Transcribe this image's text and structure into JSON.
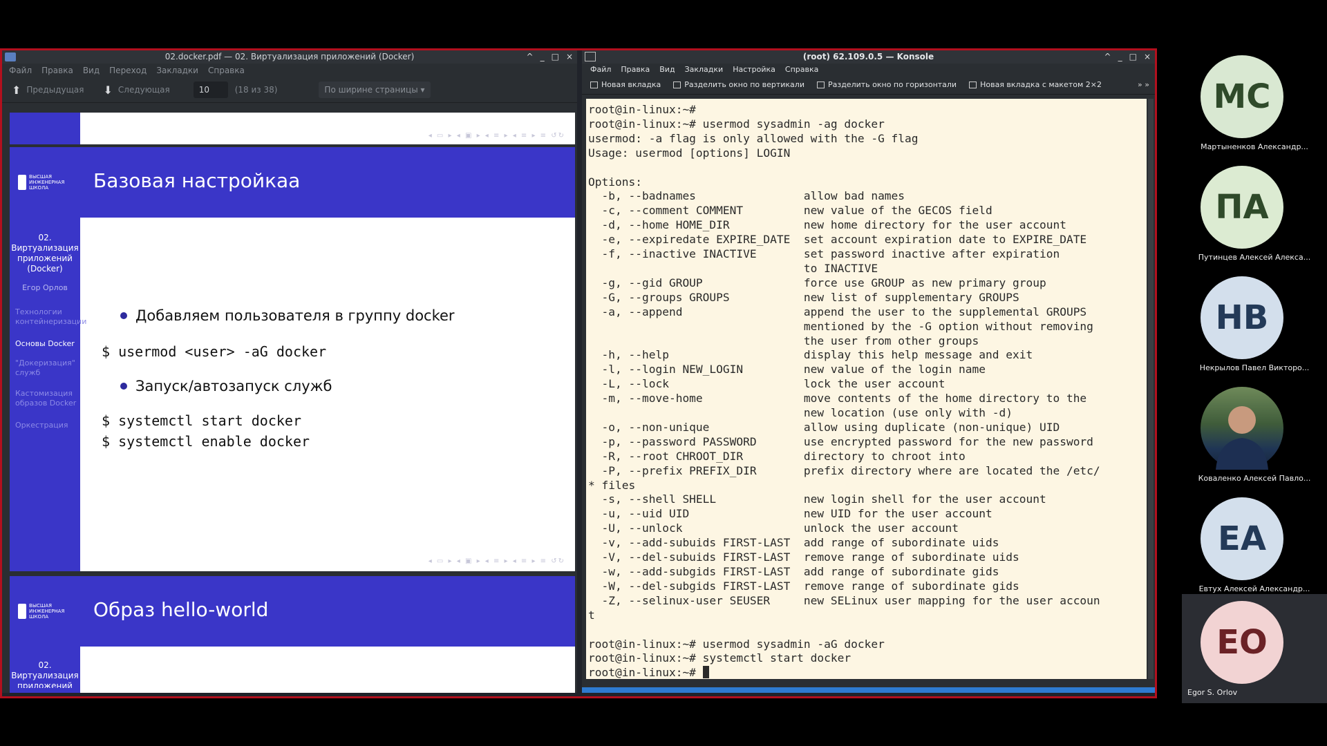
{
  "okular": {
    "title": "02.docker.pdf — 02. Виртуализация приложений (Docker)",
    "menu": [
      "Файл",
      "Правка",
      "Вид",
      "Переход",
      "Закладки",
      "Справка"
    ],
    "toolbar": {
      "prev_label": "Предыдущая",
      "next_label": "Следующая",
      "page_value": "10",
      "page_of": "(18 из 38)",
      "zoom": "По ширине страницы"
    }
  },
  "slide_main": {
    "title": "Базовая настройкаа",
    "section_title": "02. Виртуализация приложений (Docker)",
    "author": "Егор Орлов",
    "nav": [
      "Технологии контейнеризации",
      "Основы Docker",
      "\"Докеризация\" служб",
      "Кастомизация образов Docker",
      "Оркестрация"
    ],
    "bullet1": "Добавляем пользователя в группу docker",
    "code1": "$ usermod <user> -aG docker",
    "bullet2": "Запуск/автозапуск служб",
    "code2": "$ systemctl start docker",
    "code3": "$ systemctl enable docker"
  },
  "slide_next": {
    "title": "Образ hello-world",
    "section_title": "02. Виртуализация приложений"
  },
  "logo_text": "ВЫСШАЯ ИНЖЕНЕРНАЯ ШКОЛА",
  "konsole": {
    "title": "(root) 62.109.0.5 — Konsole",
    "menu": [
      "Файл",
      "Правка",
      "Вид",
      "Закладки",
      "Настройка",
      "Справка"
    ],
    "toolbar": [
      "Новая вкладка",
      "Разделить окно по вертикали",
      "Разделить окно по горизонтали",
      "Новая вкладка с макетом 2×2"
    ],
    "output": "root@in-linux:~#\nroot@in-linux:~# usermod sysadmin -ag docker\nusermod: -a flag is only allowed with the -G flag\nUsage: usermod [options] LOGIN\n\nOptions:\n  -b, --badnames                allow bad names\n  -c, --comment COMMENT         new value of the GECOS field\n  -d, --home HOME_DIR           new home directory for the user account\n  -e, --expiredate EXPIRE_DATE  set account expiration date to EXPIRE_DATE\n  -f, --inactive INACTIVE       set password inactive after expiration\n                                to INACTIVE\n  -g, --gid GROUP               force use GROUP as new primary group\n  -G, --groups GROUPS           new list of supplementary GROUPS\n  -a, --append                  append the user to the supplemental GROUPS\n                                mentioned by the -G option without removing\n                                the user from other groups\n  -h, --help                    display this help message and exit\n  -l, --login NEW_LOGIN         new value of the login name\n  -L, --lock                    lock the user account\n  -m, --move-home               move contents of the home directory to the\n                                new location (use only with -d)\n  -o, --non-unique              allow using duplicate (non-unique) UID\n  -p, --password PASSWORD       use encrypted password for the new password\n  -R, --root CHROOT_DIR         directory to chroot into\n  -P, --prefix PREFIX_DIR       prefix directory where are located the /etc/\n* files\n  -s, --shell SHELL             new login shell for the user account\n  -u, --uid UID                 new UID for the user account\n  -U, --unlock                  unlock the user account\n  -v, --add-subuids FIRST-LAST  add range of subordinate uids\n  -V, --del-subuids FIRST-LAST  remove range of subordinate uids\n  -w, --add-subgids FIRST-LAST  add range of subordinate gids\n  -W, --del-subgids FIRST-LAST  remove range of subordinate gids\n  -Z, --selinux-user SEUSER     new SELinux user mapping for the user accoun\nt\n\nroot@in-linux:~# usermod sysadmin -aG docker\nroot@in-linux:~# systemctl start docker\nroot@in-linux:~# "
  },
  "participants": [
    {
      "initials": "МС",
      "name": "Мартыненков Александр...",
      "bg": "#d9e8d2",
      "fg": "#2f4a2a"
    },
    {
      "initials": "ПА",
      "name": "Путинцев Алексей Алекса...",
      "bg": "#dcebd2",
      "fg": "#2f4a2a"
    },
    {
      "initials": "НВ",
      "name": "Некрылов Павел Викторо...",
      "bg": "#d3dfec",
      "fg": "#233a58"
    },
    {
      "initials": "",
      "name": "Коваленко Алексей Павло...",
      "bg": "#3c5a3a",
      "fg": "#ffffff"
    },
    {
      "initials": "ЕА",
      "name": "Евтух Алексей Александр...",
      "bg": "#d3dfec",
      "fg": "#233a58"
    },
    {
      "initials": "ЕО",
      "name": "Egor S. Orlov",
      "bg": "#f2d3d3",
      "fg": "#6b2226"
    }
  ]
}
